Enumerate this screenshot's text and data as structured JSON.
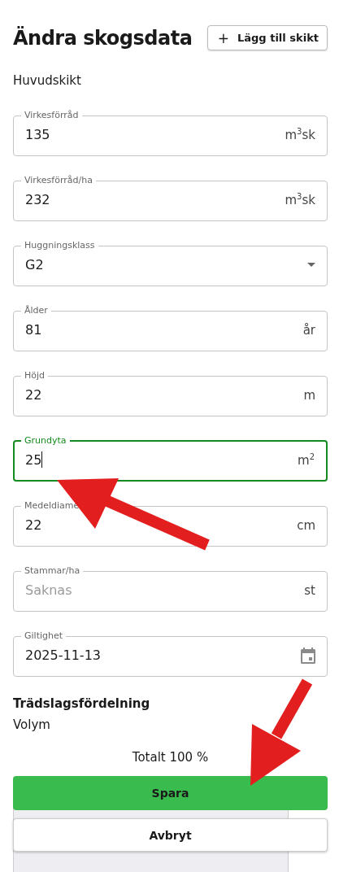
{
  "title": "Ändra skogsdata",
  "add_layer_button": {
    "icon": "+",
    "label": "Lägg till skikt"
  },
  "section": "Huvudskikt",
  "fields": [
    {
      "kind": "input",
      "label": "Virkesförråd",
      "value": "135",
      "unit": "m$^{3}$sk",
      "focused": false
    },
    {
      "kind": "input",
      "label": "Virkesförråd/ha",
      "value": "232",
      "unit": "m$^{3}$sk",
      "focused": false
    },
    {
      "kind": "select",
      "label": "Huggningsklass",
      "value": "G2",
      "focused": false
    },
    {
      "kind": "input",
      "label": "Ålder",
      "value": "81",
      "unit": "år",
      "focused": false
    },
    {
      "kind": "input",
      "label": "Höjd",
      "value": "22",
      "unit": "m",
      "focused": false
    },
    {
      "kind": "input",
      "label": "Grundyta",
      "value": "25",
      "unit": "m$^{2}$",
      "focused": true
    },
    {
      "kind": "input",
      "label": "Medeldiame",
      "value": "22",
      "unit": "cm",
      "focused": false
    },
    {
      "kind": "input",
      "label": "Stammar/ha",
      "placeholder": "Saknas",
      "unit": "st",
      "focused": false
    },
    {
      "kind": "date",
      "label": "Giltighet",
      "value": "2025-11-13",
      "focused": false
    }
  ],
  "distribution": {
    "heading": "Trädslagsfördelning",
    "subheading": "Volym",
    "total": "Totalt 100 %"
  },
  "buttons": [
    {
      "kind": "primary",
      "label": "Spara"
    },
    {
      "kind": "secondary",
      "label": "Avbryt"
    }
  ]
}
